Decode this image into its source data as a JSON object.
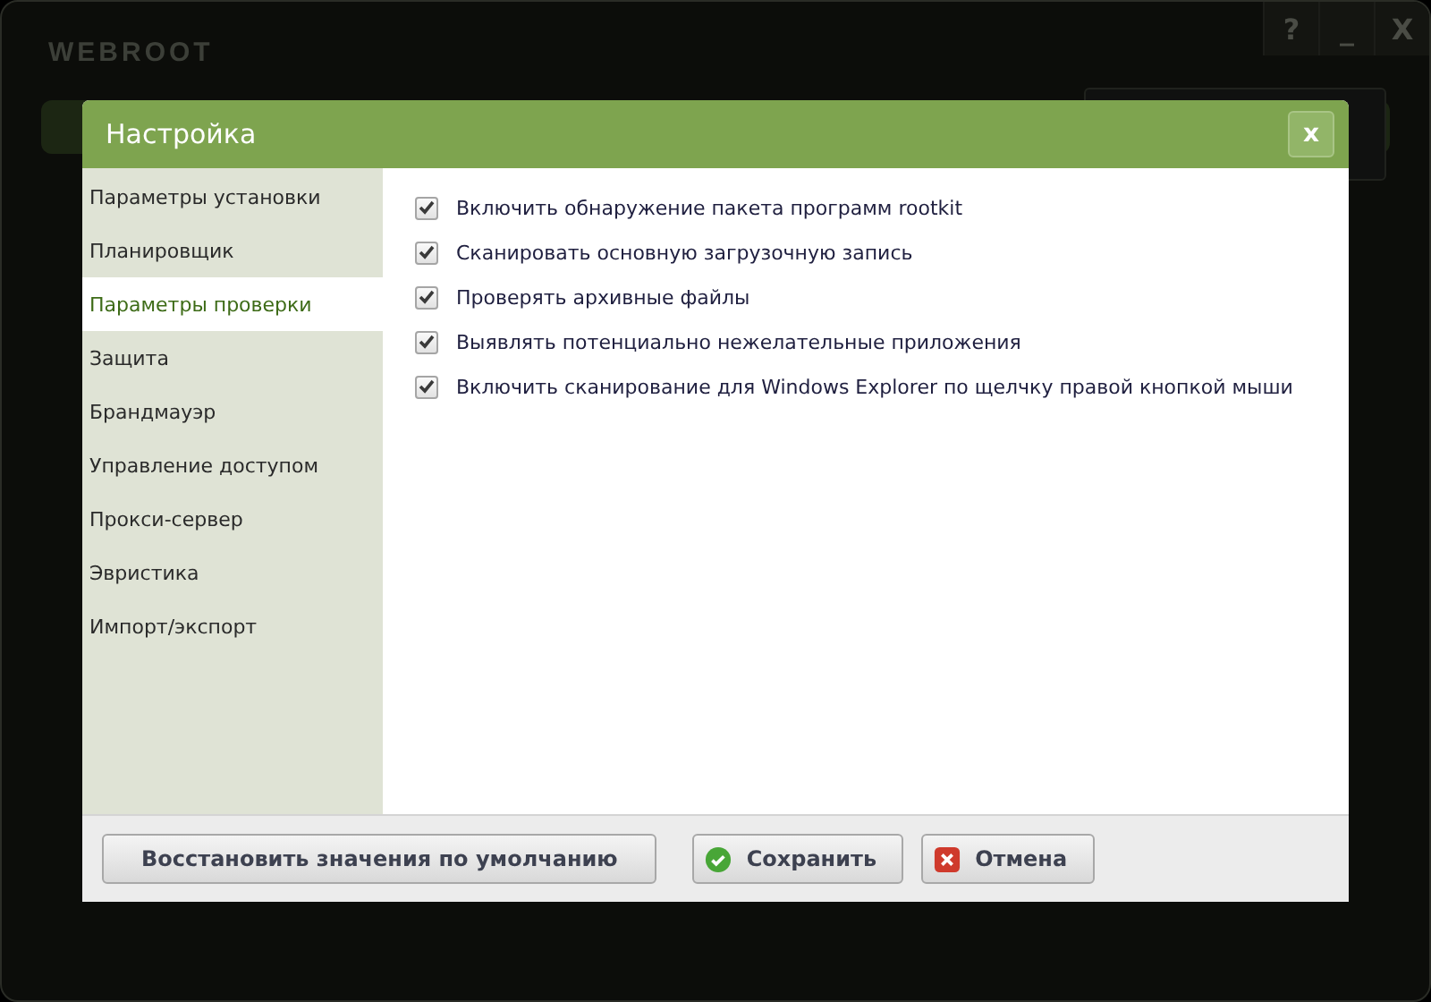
{
  "app": {
    "brand": "WEBROOT",
    "window_buttons": [
      "?",
      "_",
      "X"
    ]
  },
  "dialog": {
    "title": "Настройка",
    "close": "x",
    "sidebar": [
      {
        "label": "Параметры установки",
        "selected": false
      },
      {
        "label": "Планировщик",
        "selected": false
      },
      {
        "label": "Параметры проверки",
        "selected": true
      },
      {
        "label": "Защита",
        "selected": false
      },
      {
        "label": "Брандмауэр",
        "selected": false
      },
      {
        "label": "Управление доступом",
        "selected": false
      },
      {
        "label": "Прокси-сервер",
        "selected": false
      },
      {
        "label": "Эвристика",
        "selected": false
      },
      {
        "label": "Импорт/экспорт",
        "selected": false
      }
    ],
    "options": [
      {
        "label": "Включить обнаружение пакета программ rootkit",
        "checked": true
      },
      {
        "label": "Сканировать основную загрузочную запись",
        "checked": true
      },
      {
        "label": "Проверять архивные файлы",
        "checked": true
      },
      {
        "label": "Выявлять потенциально нежелательные приложения",
        "checked": true
      },
      {
        "label": "Включить сканирование для Windows Explorer по щелчку правой кнопкой мыши",
        "checked": true
      }
    ],
    "buttons": [
      {
        "label": "Восстановить значения по умолчанию",
        "kind": "plain"
      },
      {
        "label": "Сохранить",
        "kind": "ok"
      },
      {
        "label": "Отмена",
        "kind": "cancel"
      }
    ]
  }
}
